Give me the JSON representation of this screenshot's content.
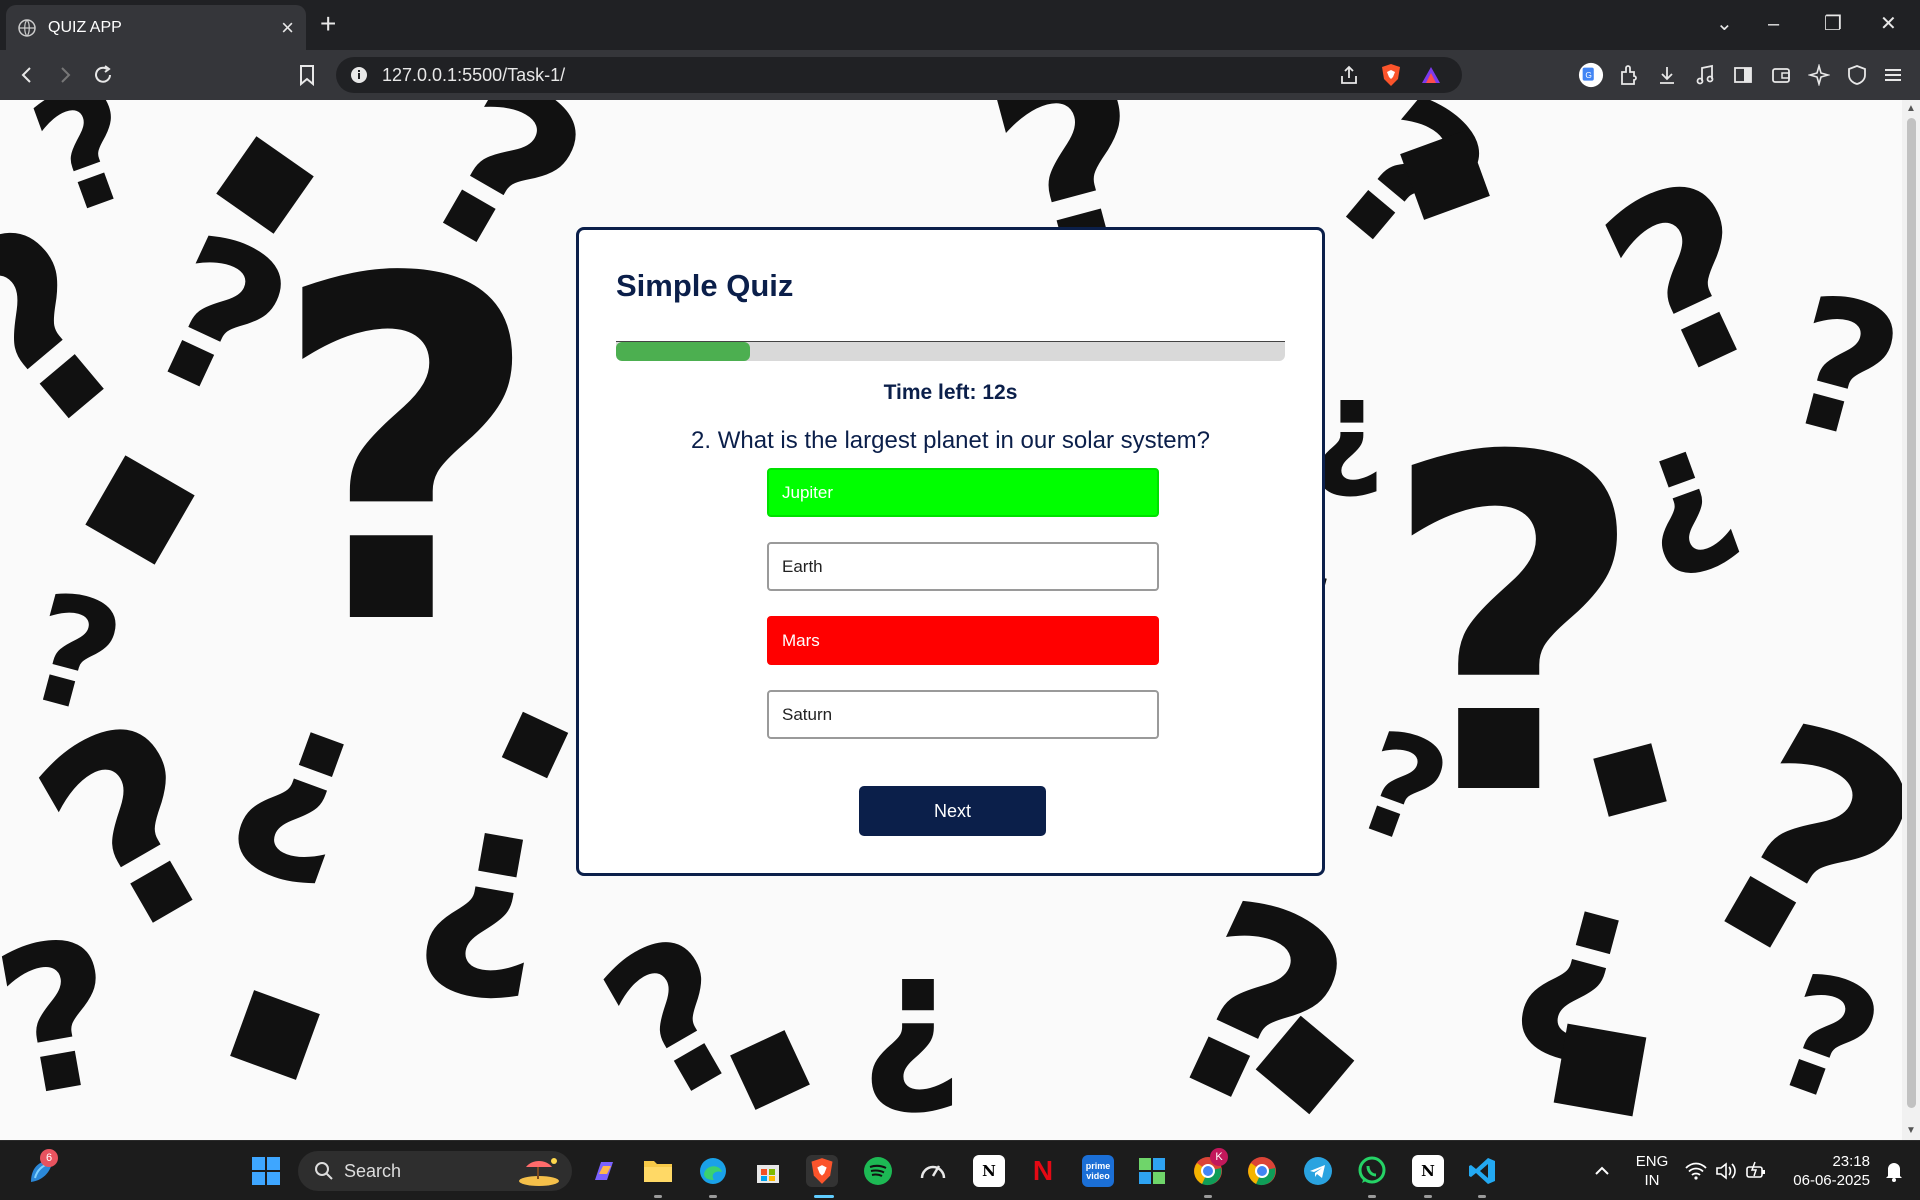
{
  "browser": {
    "tab_title": "QUIZ APP",
    "new_tab_label": "+",
    "url": "127.0.0.1:5500/Task-1/"
  },
  "quiz": {
    "title": "Simple Quiz",
    "progress_fraction": 0.2,
    "time_left": "Time left: 12s",
    "question": "2. What is the largest planet in our solar system?",
    "options": [
      {
        "label": "Jupiter",
        "state": "correct"
      },
      {
        "label": "Earth",
        "state": "neutral"
      },
      {
        "label": "Mars",
        "state": "wrong"
      },
      {
        "label": "Saturn",
        "state": "neutral"
      }
    ],
    "next_label": "Next"
  },
  "colors": {
    "accent": "#0b1f4a",
    "progress": "#4caf50",
    "correct": "#00ff00",
    "wrong": "#ff0000"
  },
  "taskbar": {
    "search_label": "Search",
    "widgets_badge": "6",
    "chrome_profile_badge": "K",
    "language_line1": "ENG",
    "language_line2": "IN",
    "time": "23:18",
    "date": "06-06-2025"
  }
}
